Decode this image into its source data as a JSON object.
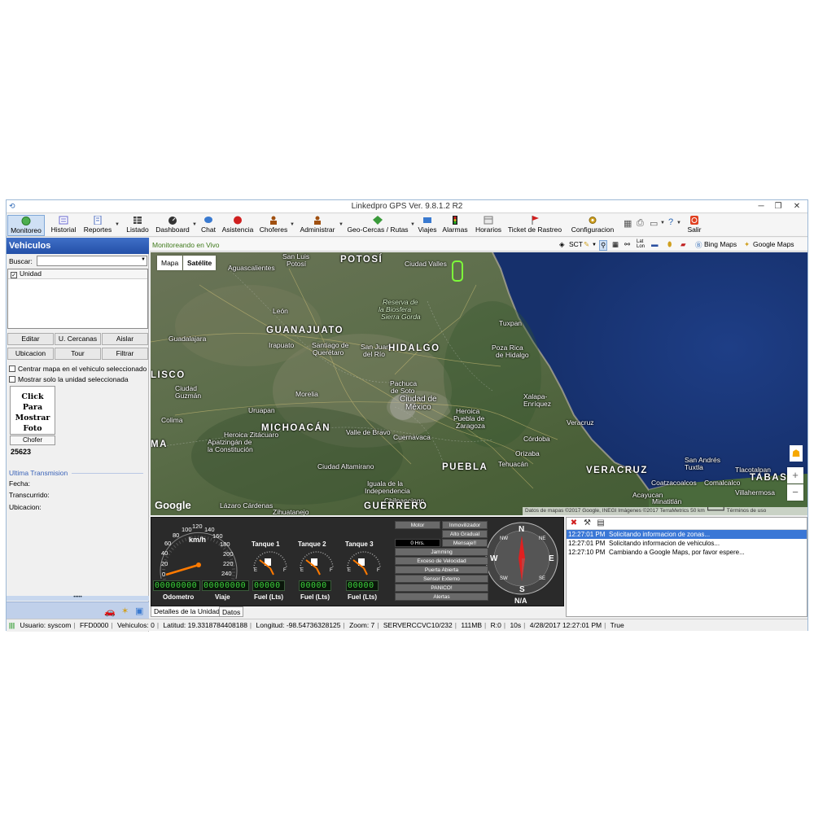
{
  "window": {
    "title": "Linkedpro GPS Ver. 9.8.1.2 R2",
    "app_icon": "linkedpro-app-icon"
  },
  "toolbar": {
    "items": [
      {
        "label": "Monitoreo",
        "icon": "monitor-icon",
        "color": "#4caf50"
      },
      {
        "label": "Historial",
        "icon": "history-icon",
        "color": "#6a6ad0"
      },
      {
        "label": "Reportes",
        "icon": "reports-icon",
        "color": "#5070c0"
      },
      {
        "label": "Listado",
        "icon": "list-icon",
        "color": "#333333"
      },
      {
        "label": "Dashboard",
        "icon": "dashboard-icon",
        "color": "#333333"
      },
      {
        "label": "Chat",
        "icon": "chat-icon",
        "color": "#3a7ad0"
      },
      {
        "label": "Asistencia",
        "icon": "assistance-icon",
        "color": "#d02020"
      },
      {
        "label": "Choferes",
        "icon": "drivers-icon",
        "color": "#a05010"
      },
      {
        "label": "Administrar",
        "icon": "admin-icon",
        "color": "#a05010"
      },
      {
        "label": "Geo-Cercas / Rutas",
        "icon": "geofence-icon",
        "color": "#3a9a3a"
      },
      {
        "label": "Viajes",
        "icon": "trips-icon",
        "color": "#3a7ad0"
      },
      {
        "label": "Alarmas",
        "icon": "alarms-icon",
        "color": "#d0a020"
      },
      {
        "label": "Horarios",
        "icon": "schedule-icon",
        "color": "#7a7a7a"
      },
      {
        "label": "Ticket de Rastreo",
        "icon": "ticket-icon",
        "color": "#d02020"
      },
      {
        "label": "Configuracion",
        "icon": "config-icon",
        "color": "#d0a020"
      },
      {
        "label": "Salir",
        "icon": "exit-icon",
        "color": "#e04020"
      }
    ]
  },
  "left_panel": {
    "header": "Vehiculos",
    "search_label": "Buscar:",
    "search_value": "",
    "list_column": "Unidad",
    "list_column_checked": true,
    "buttons": [
      "Editar",
      "U. Cercanas",
      "Aislar",
      "Ubicacion",
      "Tour",
      "Filtrar"
    ],
    "checkboxes": [
      {
        "label": "Centrar mapa en el vehiculo seleccionado",
        "checked": false
      },
      {
        "label": "Mostrar solo la unidad seleccionada",
        "checked": false
      }
    ],
    "photo_text_1": "Click Para",
    "photo_text_2": "Mostrar",
    "photo_text_3": "Foto",
    "chofer_button": "Chofer",
    "chofer_id": "25623",
    "last_transmission_title": "Ultima Transmision",
    "fields": [
      "Fecha:",
      "Transcurrido:",
      "Ubicacion:"
    ],
    "splitter": "•••••"
  },
  "map_header": {
    "status": "Monitoreando en Vivo",
    "sct": "SCT",
    "bing": "Bing Maps",
    "google": "Google Maps"
  },
  "map": {
    "tab_map": "Mapa",
    "tab_satellite": "Satélite",
    "logo": "Google",
    "attribution": "Datos de mapas ©2017 Google, INEGI Imágenes ©2017 TerraMetrics   50 km ┗━━━━┛   Términos de uso",
    "zoom_in": "+",
    "zoom_out": "−",
    "labels": {
      "aguascalientes": "Aguascalientes",
      "sanluis": "San Luis",
      "potosi_city": "Potosí",
      "potosi_state": "POTOSÍ",
      "ciudad_valles": "Ciudad Valles",
      "leon": "León",
      "guanajuato": "GUANAJUATO",
      "reserva": "Reserva de",
      "biosfera": "la Biosfera",
      "sierra_gorda": "Sierra Gorda",
      "tuxpan": "Tuxpan",
      "guadalajara": "Guadalajara",
      "irapuato": "Irapuato",
      "santiago": "Santiago de",
      "queretaro": "Querétaro",
      "sanjuan": "San Juan",
      "delrio": "del Río",
      "hidalgo": "HIDALGO",
      "pozarica": "Poza Rica",
      "pozarica2": "de Hidalgo",
      "lisco": "LISCO",
      "ciudad_guzman": "Ciudad",
      "ciudad_guzman2": "Guzmán",
      "morelia": "Morelia",
      "pachuca": "Pachuca",
      "pachuca2": "de Soto",
      "xalapa": "Xalapa-",
      "xalapa2": "Enríquez",
      "colima": "Colima",
      "uruapan": "Uruapan",
      "ciudad_mexico": "Ciudad de",
      "ciudad_mexico2": "México",
      "michoacan": "MICHOACÁN",
      "heroica": "Heroica",
      "heroica2": "Puebla de",
      "heroica3": "Zaragoza",
      "veracruz_city": "Veracruz",
      "ma": "MA",
      "lazaro": "Lázaro Cárdenas",
      "zihuatanejo": "Zihuatanejo",
      "valle_bravo": "Valle de Bravo",
      "cuernavaca": "Cuernavaca",
      "cordoba": "Córdoba",
      "orizaba": "Orizaba",
      "puebla": "PUEBLA",
      "tehuacan": "Tehuacán",
      "veracruz": "VERACRUZ",
      "tlacotalpan": "Tlacotalpan",
      "tabasco": "TABASC",
      "guerrero": "GUERRERO",
      "iguala": "Iguala de la",
      "iguala2": "Independencia",
      "chilpancingo": "Chilpancingo",
      "acayucan": "Acayucan",
      "coatzacoalcos": "Coatzacoalcos",
      "villahermosa": "Villahermosa",
      "comalcalco": "Comalcalco",
      "heroica_zitacuaro": "Heroica Zitácuaro",
      "apatzingan": "Apatzingán de",
      "apatzingan2": "la Constitución",
      "ciudad_altamirano": "Ciudad Altamirano",
      "san_andres": "San Andrés",
      "san_andres2": "Tuxtla",
      "minatitlan": "Minatitlán"
    }
  },
  "dashboard": {
    "speed_unit": "km/h",
    "speed_ticks": [
      "0",
      "20",
      "40",
      "60",
      "80",
      "100",
      "120",
      "140",
      "160",
      "180",
      "200",
      "220",
      "240"
    ],
    "odometer_value": "00000000",
    "trip_value": "00000000",
    "odometer_label": "Odometro",
    "trip_label": "Viaje",
    "tanks": [
      {
        "title": "Tanque 1",
        "value": "00000",
        "label": "Fuel (Lts)",
        "level": 0
      },
      {
        "title": "Tanque 2",
        "value": "00000",
        "label": "Fuel (Lts)",
        "level": 0
      },
      {
        "title": "Tanque 3",
        "value": "00000",
        "label": "Fuel (Lts)",
        "level": 0
      }
    ],
    "tank_scale_empty": "E",
    "tank_scale_full": "F",
    "status": {
      "motor": "Motor",
      "inmovilizador": "Inmovilizador",
      "alto_gradual": "Alto Gradual",
      "hrs": "0 Hrs.",
      "mensaje": "Mensaje!!",
      "jamming": "Jamming",
      "exceso": "Exceso de Velocidad",
      "puerta": "Puerta Abierta",
      "sensor": "Sensor Externo",
      "panico": "PANICO!",
      "alertas": "Alertas"
    },
    "compass": {
      "n": "N",
      "s": "S",
      "e": "E",
      "w": "W",
      "ne": "NE",
      "nw": "NW",
      "se": "SE",
      "sw": "SW",
      "reading": "N/A"
    },
    "tabs": [
      "Detalles de la Unidad",
      "Datos"
    ]
  },
  "log": {
    "entries": [
      {
        "time": "12:27:01 PM",
        "text": "Solicitando informacion de zonas...",
        "selected": true
      },
      {
        "time": "12:27:01 PM",
        "text": "Solicitando informacion de vehiculos...",
        "selected": false
      },
      {
        "time": "12:27:10 PM",
        "text": "Cambiando a Google Maps, por favor espere...",
        "selected": false
      }
    ]
  },
  "status_bar": {
    "user": "Usuario:  syscom",
    "code": "FFD0000",
    "vehicles": "Vehiculos:  0",
    "lat": "Latitud:  19.3318784408188",
    "lng": "Longitud:   -98.54736328125",
    "zoom": "Zoom:  7",
    "server": "SERVERCCVC10/232",
    "memory": "111MB",
    "r": "R:0",
    "secs": "10s",
    "datetime": "4/28/2017 12:27:01 PM",
    "flag": "True"
  }
}
